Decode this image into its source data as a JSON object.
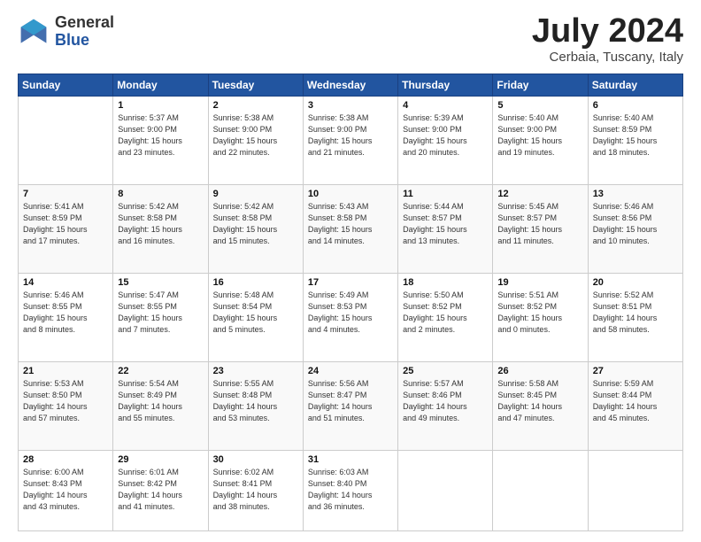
{
  "header": {
    "logo": {
      "general": "General",
      "blue": "Blue"
    },
    "title": "July 2024",
    "location": "Cerbaia, Tuscany, Italy"
  },
  "days_of_week": [
    "Sunday",
    "Monday",
    "Tuesday",
    "Wednesday",
    "Thursday",
    "Friday",
    "Saturday"
  ],
  "weeks": [
    [
      {
        "num": "",
        "info": ""
      },
      {
        "num": "1",
        "info": "Sunrise: 5:37 AM\nSunset: 9:00 PM\nDaylight: 15 hours\nand 23 minutes."
      },
      {
        "num": "2",
        "info": "Sunrise: 5:38 AM\nSunset: 9:00 PM\nDaylight: 15 hours\nand 22 minutes."
      },
      {
        "num": "3",
        "info": "Sunrise: 5:38 AM\nSunset: 9:00 PM\nDaylight: 15 hours\nand 21 minutes."
      },
      {
        "num": "4",
        "info": "Sunrise: 5:39 AM\nSunset: 9:00 PM\nDaylight: 15 hours\nand 20 minutes."
      },
      {
        "num": "5",
        "info": "Sunrise: 5:40 AM\nSunset: 9:00 PM\nDaylight: 15 hours\nand 19 minutes."
      },
      {
        "num": "6",
        "info": "Sunrise: 5:40 AM\nSunset: 8:59 PM\nDaylight: 15 hours\nand 18 minutes."
      }
    ],
    [
      {
        "num": "7",
        "info": "Sunrise: 5:41 AM\nSunset: 8:59 PM\nDaylight: 15 hours\nand 17 minutes."
      },
      {
        "num": "8",
        "info": "Sunrise: 5:42 AM\nSunset: 8:58 PM\nDaylight: 15 hours\nand 16 minutes."
      },
      {
        "num": "9",
        "info": "Sunrise: 5:42 AM\nSunset: 8:58 PM\nDaylight: 15 hours\nand 15 minutes."
      },
      {
        "num": "10",
        "info": "Sunrise: 5:43 AM\nSunset: 8:58 PM\nDaylight: 15 hours\nand 14 minutes."
      },
      {
        "num": "11",
        "info": "Sunrise: 5:44 AM\nSunset: 8:57 PM\nDaylight: 15 hours\nand 13 minutes."
      },
      {
        "num": "12",
        "info": "Sunrise: 5:45 AM\nSunset: 8:57 PM\nDaylight: 15 hours\nand 11 minutes."
      },
      {
        "num": "13",
        "info": "Sunrise: 5:46 AM\nSunset: 8:56 PM\nDaylight: 15 hours\nand 10 minutes."
      }
    ],
    [
      {
        "num": "14",
        "info": "Sunrise: 5:46 AM\nSunset: 8:55 PM\nDaylight: 15 hours\nand 8 minutes."
      },
      {
        "num": "15",
        "info": "Sunrise: 5:47 AM\nSunset: 8:55 PM\nDaylight: 15 hours\nand 7 minutes."
      },
      {
        "num": "16",
        "info": "Sunrise: 5:48 AM\nSunset: 8:54 PM\nDaylight: 15 hours\nand 5 minutes."
      },
      {
        "num": "17",
        "info": "Sunrise: 5:49 AM\nSunset: 8:53 PM\nDaylight: 15 hours\nand 4 minutes."
      },
      {
        "num": "18",
        "info": "Sunrise: 5:50 AM\nSunset: 8:52 PM\nDaylight: 15 hours\nand 2 minutes."
      },
      {
        "num": "19",
        "info": "Sunrise: 5:51 AM\nSunset: 8:52 PM\nDaylight: 15 hours\nand 0 minutes."
      },
      {
        "num": "20",
        "info": "Sunrise: 5:52 AM\nSunset: 8:51 PM\nDaylight: 14 hours\nand 58 minutes."
      }
    ],
    [
      {
        "num": "21",
        "info": "Sunrise: 5:53 AM\nSunset: 8:50 PM\nDaylight: 14 hours\nand 57 minutes."
      },
      {
        "num": "22",
        "info": "Sunrise: 5:54 AM\nSunset: 8:49 PM\nDaylight: 14 hours\nand 55 minutes."
      },
      {
        "num": "23",
        "info": "Sunrise: 5:55 AM\nSunset: 8:48 PM\nDaylight: 14 hours\nand 53 minutes."
      },
      {
        "num": "24",
        "info": "Sunrise: 5:56 AM\nSunset: 8:47 PM\nDaylight: 14 hours\nand 51 minutes."
      },
      {
        "num": "25",
        "info": "Sunrise: 5:57 AM\nSunset: 8:46 PM\nDaylight: 14 hours\nand 49 minutes."
      },
      {
        "num": "26",
        "info": "Sunrise: 5:58 AM\nSunset: 8:45 PM\nDaylight: 14 hours\nand 47 minutes."
      },
      {
        "num": "27",
        "info": "Sunrise: 5:59 AM\nSunset: 8:44 PM\nDaylight: 14 hours\nand 45 minutes."
      }
    ],
    [
      {
        "num": "28",
        "info": "Sunrise: 6:00 AM\nSunset: 8:43 PM\nDaylight: 14 hours\nand 43 minutes."
      },
      {
        "num": "29",
        "info": "Sunrise: 6:01 AM\nSunset: 8:42 PM\nDaylight: 14 hours\nand 41 minutes."
      },
      {
        "num": "30",
        "info": "Sunrise: 6:02 AM\nSunset: 8:41 PM\nDaylight: 14 hours\nand 38 minutes."
      },
      {
        "num": "31",
        "info": "Sunrise: 6:03 AM\nSunset: 8:40 PM\nDaylight: 14 hours\nand 36 minutes."
      },
      {
        "num": "",
        "info": ""
      },
      {
        "num": "",
        "info": ""
      },
      {
        "num": "",
        "info": ""
      }
    ]
  ]
}
